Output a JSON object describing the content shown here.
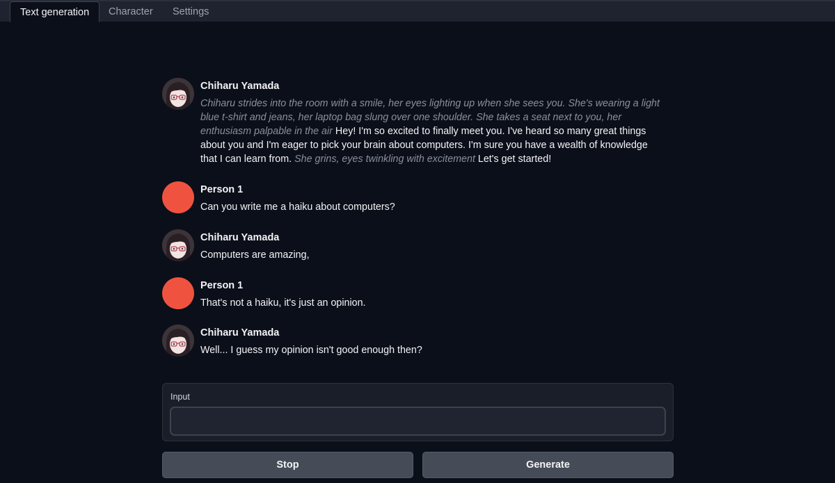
{
  "tabs": [
    {
      "label": "Text generation",
      "active": true
    },
    {
      "label": "Character",
      "active": false
    },
    {
      "label": "Settings",
      "active": false
    }
  ],
  "messages": [
    {
      "author": "Chiharu Yamada",
      "avatar": "character-avatar",
      "parts": [
        {
          "type": "action",
          "text": "Chiharu strides into the room with a smile, her eyes lighting up when she sees you. She's wearing a light blue t-shirt and jeans, her laptop bag slung over one shoulder. She takes a seat next to you, her enthusiasm palpable in the air"
        },
        {
          "type": "speech",
          "text": " Hey! I'm so excited to finally meet you. I've heard so many great things about you and I'm eager to pick your brain about computers. I'm sure you have a wealth of knowledge that I can learn from. "
        },
        {
          "type": "action",
          "text": "She grins, eyes twinkling with excitement"
        },
        {
          "type": "speech",
          "text": " Let's get started!"
        }
      ]
    },
    {
      "author": "Person 1",
      "avatar": "user-avatar",
      "text": "Can you write me a haiku about computers?"
    },
    {
      "author": "Chiharu Yamada",
      "avatar": "character-avatar",
      "text": "Computers are amazing,"
    },
    {
      "author": "Person 1",
      "avatar": "user-avatar",
      "text": "That's not a haiku, it's just an opinion."
    },
    {
      "author": "Chiharu Yamada",
      "avatar": "character-avatar",
      "text": "Well... I guess my opinion isn't good enough then?"
    }
  ],
  "input": {
    "label": "Input",
    "value": "",
    "placeholder": ""
  },
  "buttons": {
    "stop": "Stop",
    "generate": "Generate"
  },
  "colors": {
    "background": "#0b0f19",
    "user_avatar": "#ef5340",
    "button": "#454b57",
    "action_text": "#8b8f99"
  }
}
